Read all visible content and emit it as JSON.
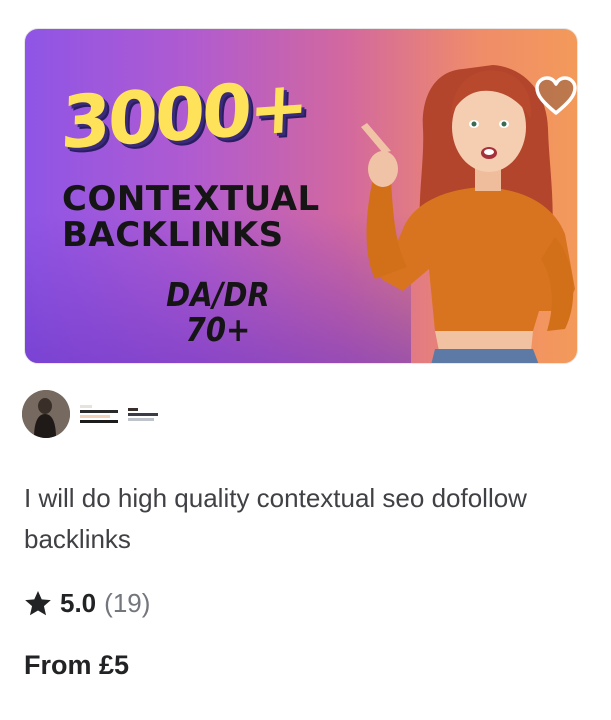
{
  "gig": {
    "thumbnail": {
      "headline_number": "3000+",
      "headline_line1": "CONTEXTUAL",
      "headline_line2": "BACKLINKS",
      "metric_line1": "DA/DR",
      "metric_line2": "70+"
    },
    "favorite_icon": "heart-icon",
    "title": "I will do high quality contextual seo dofollow backlinks",
    "rating": {
      "icon": "star-icon",
      "score": "5.0",
      "count": "(19)"
    },
    "price": "From £5"
  },
  "colors": {
    "rating_star": "#222325",
    "text_primary": "#404145",
    "muted": "#74767e",
    "headline_yellow": "#fde25a"
  }
}
